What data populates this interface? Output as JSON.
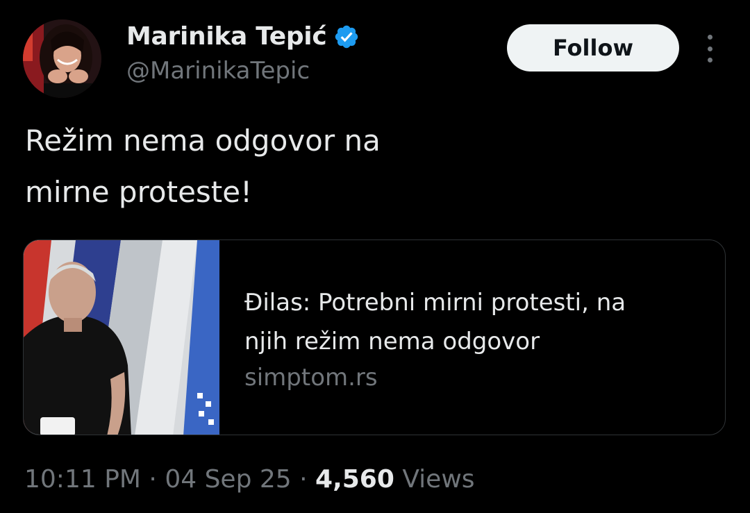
{
  "author": {
    "display_name": "Marinika Tepić",
    "handle": "@MarinikaTepic",
    "verified": true,
    "verified_icon": "verified-badge-icon",
    "verified_color": "#1d9bf0"
  },
  "actions": {
    "follow_label": "Follow",
    "more_icon": "more-vertical-icon"
  },
  "tweet": {
    "text": "Režim nema odgovor na\nmirne proteste!"
  },
  "link_card": {
    "title": "Đilas: Potrebni mirni protesti, na\nnjih režim nema odgovor",
    "domain": "simptom.rs"
  },
  "meta": {
    "time": "10:11 PM",
    "separator": " · ",
    "date": "04 Sep 25",
    "views_count": "4,560",
    "views_label": " Views"
  },
  "colors": {
    "background": "#000000",
    "text_primary": "#e7e9ea",
    "text_secondary": "#71767b",
    "accent": "#1d9bf0",
    "border": "#2f3336"
  }
}
